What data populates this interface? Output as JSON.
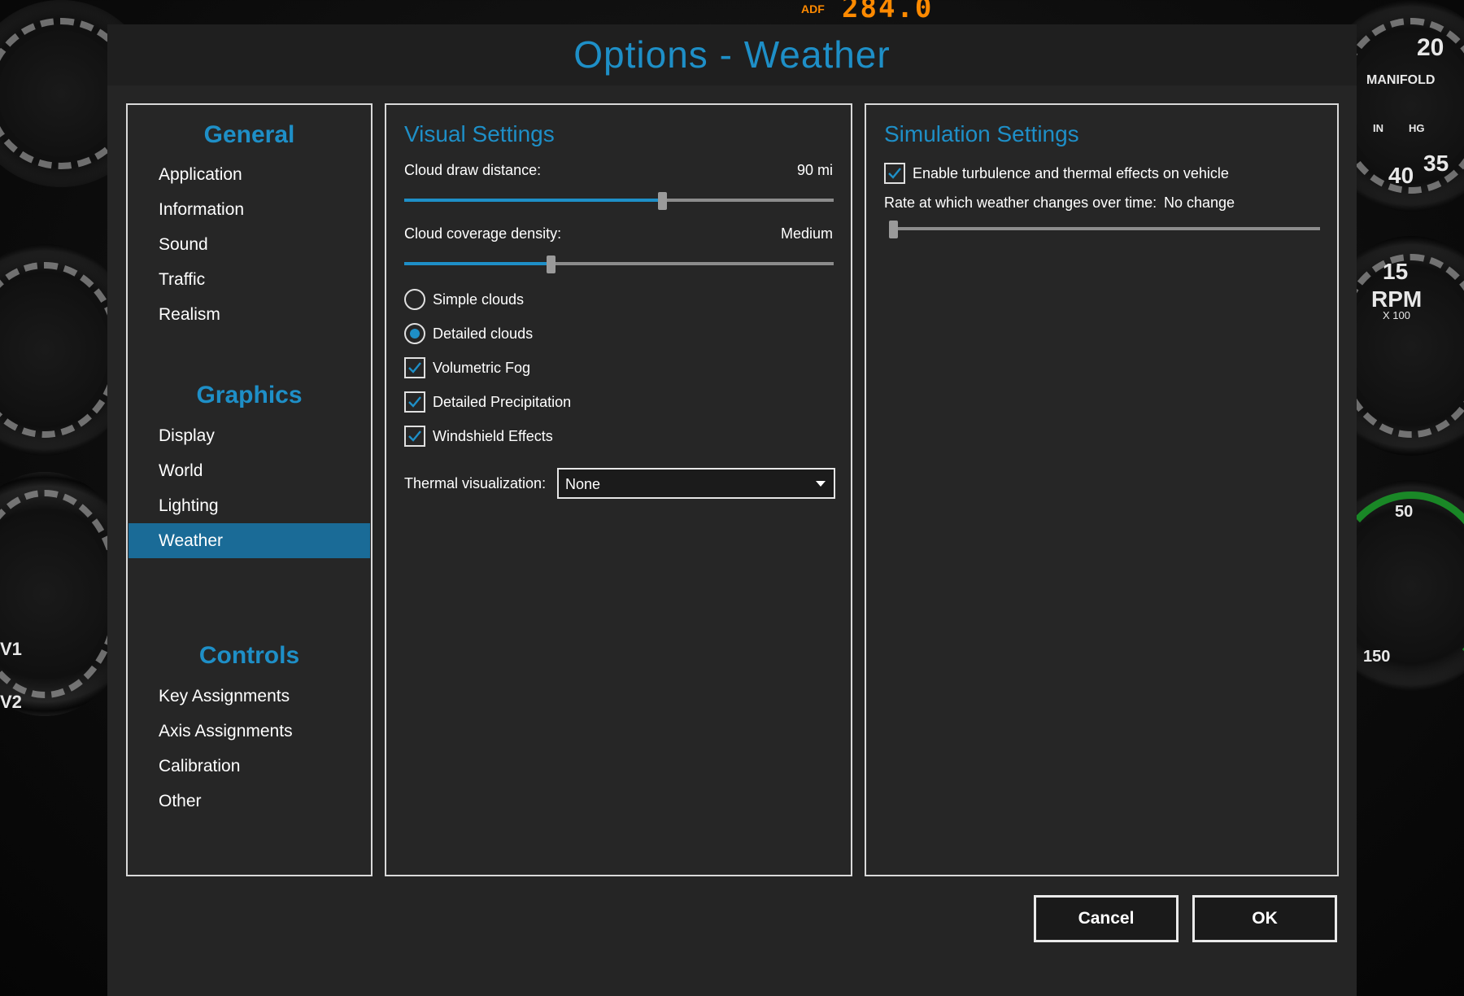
{
  "background": {
    "adf_label": "ADF",
    "adf_value": "284.0",
    "side_labels": [
      "V1",
      "V2"
    ],
    "gauge_labels": [
      "15",
      "20",
      "RPM",
      "X 100",
      "50",
      "150",
      "MANIFOLD",
      "IN",
      "HG",
      "35",
      "40"
    ]
  },
  "window": {
    "title": "Options - Weather"
  },
  "nav": {
    "sections": [
      {
        "heading": "General",
        "items": [
          "Application",
          "Information",
          "Sound",
          "Traffic",
          "Realism"
        ]
      },
      {
        "heading": "Graphics",
        "items": [
          "Display",
          "World",
          "Lighting",
          "Weather"
        ]
      },
      {
        "heading": "Controls",
        "items": [
          "Key Assignments",
          "Axis Assignments",
          "Calibration",
          "Other"
        ]
      }
    ],
    "active_item": "Weather"
  },
  "visual": {
    "title": "Visual Settings",
    "cloud_distance_label": "Cloud draw distance:",
    "cloud_distance_value": "90 mi",
    "cloud_distance_fraction": 0.6,
    "cloud_density_label": "Cloud coverage density:",
    "cloud_density_value": "Medium",
    "cloud_density_fraction": 0.34,
    "options": [
      {
        "type": "radio",
        "label": "Simple clouds",
        "checked": false
      },
      {
        "type": "radio",
        "label": "Detailed clouds",
        "checked": true
      },
      {
        "type": "checkbox",
        "label": "Volumetric Fog",
        "checked": true
      },
      {
        "type": "checkbox",
        "label": "Detailed Precipitation",
        "checked": true
      },
      {
        "type": "checkbox",
        "label": "Windshield Effects",
        "checked": true
      }
    ],
    "thermal_label": "Thermal visualization:",
    "thermal_value": "None"
  },
  "simulation": {
    "title": "Simulation Settings",
    "turbulence_label": "Enable turbulence and thermal effects on vehicle",
    "turbulence_checked": true,
    "rate_label": "Rate at which weather changes over time:",
    "rate_value": "No change",
    "rate_fraction": 0.0
  },
  "buttons": {
    "cancel": "Cancel",
    "ok": "OK"
  },
  "colors": {
    "accent": "#1e8fc7",
    "active_nav": "#1a6b97",
    "panel_bg": "#262626",
    "adf": "#ff8a00"
  }
}
